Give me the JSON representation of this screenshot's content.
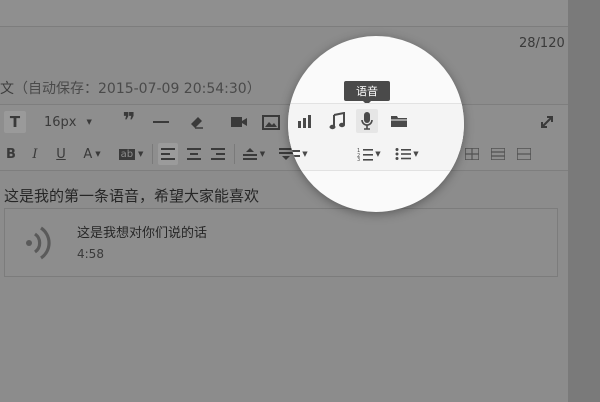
{
  "header": {
    "counter": "28/120",
    "title": "正文",
    "autosave": "（自动保存：2015-07-09 20:54:30）"
  },
  "toolbar": {
    "font_size": "16px",
    "tooltip": "语音"
  },
  "post": {
    "text": "这是我的第一条语音，希望大家能喜欢"
  },
  "voice_card": {
    "title": "这是我想对你们说的话",
    "duration": "4:58"
  }
}
